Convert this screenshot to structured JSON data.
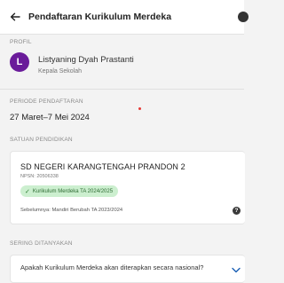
{
  "header": {
    "title": "Pendaftaran Kurikulum Merdeka",
    "back_icon": "arrow-left-icon"
  },
  "profile": {
    "section_label": "PROFIL",
    "avatar_initial": "L",
    "avatar_color": "#6a1b9a",
    "name": "Listyaning Dyah Prastanti",
    "role": "Kepala Sekolah"
  },
  "period": {
    "section_label": "PERIODE PENDAFTARAN",
    "value": "27 Maret–7 Mei 2024"
  },
  "school": {
    "section_label": "SATUAN PENDIDIKAN",
    "name": "SD NEGERI KARANGTENGAH PRANDON 2",
    "npsn": "NPSN: 20506338",
    "badge": "Kurikulum Merdeka TA 2024/2025",
    "badge_color": "#ccefcf",
    "previous": "Sebelumnya: Mandiri Berubah TA 2023/2024",
    "help_symbol": "?"
  },
  "faq": {
    "section_label": "SERING DITANYAKAN",
    "items": [
      {
        "question": "Apakah Kurikulum Merdeka akan diterapkan secara nasional?"
      }
    ]
  }
}
